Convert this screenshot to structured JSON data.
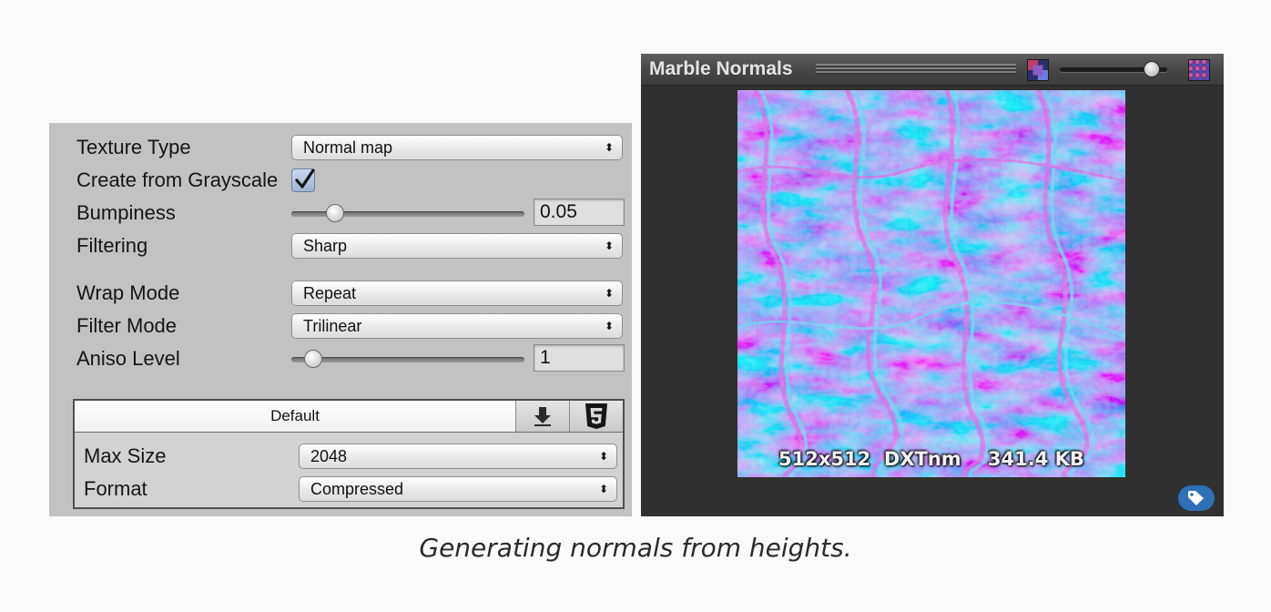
{
  "inspector": {
    "texture_type": {
      "label": "Texture Type",
      "value": "Normal map"
    },
    "create_from_grayscale": {
      "label": "Create from Grayscale",
      "checked": true
    },
    "bumpiness": {
      "label": "Bumpiness",
      "value": "0.05",
      "slider_fraction": 0.16
    },
    "filtering": {
      "label": "Filtering",
      "value": "Sharp"
    },
    "wrap_mode": {
      "label": "Wrap Mode",
      "value": "Repeat"
    },
    "filter_mode": {
      "label": "Filter Mode",
      "value": "Trilinear"
    },
    "aniso_level": {
      "label": "Aniso Level",
      "value": "1",
      "slider_fraction": 0.06
    },
    "platform": {
      "tab_default": "Default",
      "tab_icons": [
        "download-icon",
        "html5-icon"
      ],
      "max_size": {
        "label": "Max Size",
        "value": "2048"
      },
      "format": {
        "label": "Format",
        "value": "Compressed"
      }
    }
  },
  "preview": {
    "title": "Marble Normals",
    "info": "512x512  DXTnm    341.4 KB",
    "mip_slider_fraction": 0.92,
    "icons": [
      "grip-handle-icon",
      "mip-low-icon",
      "mip-high-icon",
      "asset-label-tag-icon"
    ],
    "colors": {
      "normal_base": "#8a86f0",
      "normal_pink": "#d271e4",
      "normal_cyan": "#67c7ef",
      "tag_blue": "#2f6fb5"
    }
  },
  "caption": "Generating normals from heights."
}
